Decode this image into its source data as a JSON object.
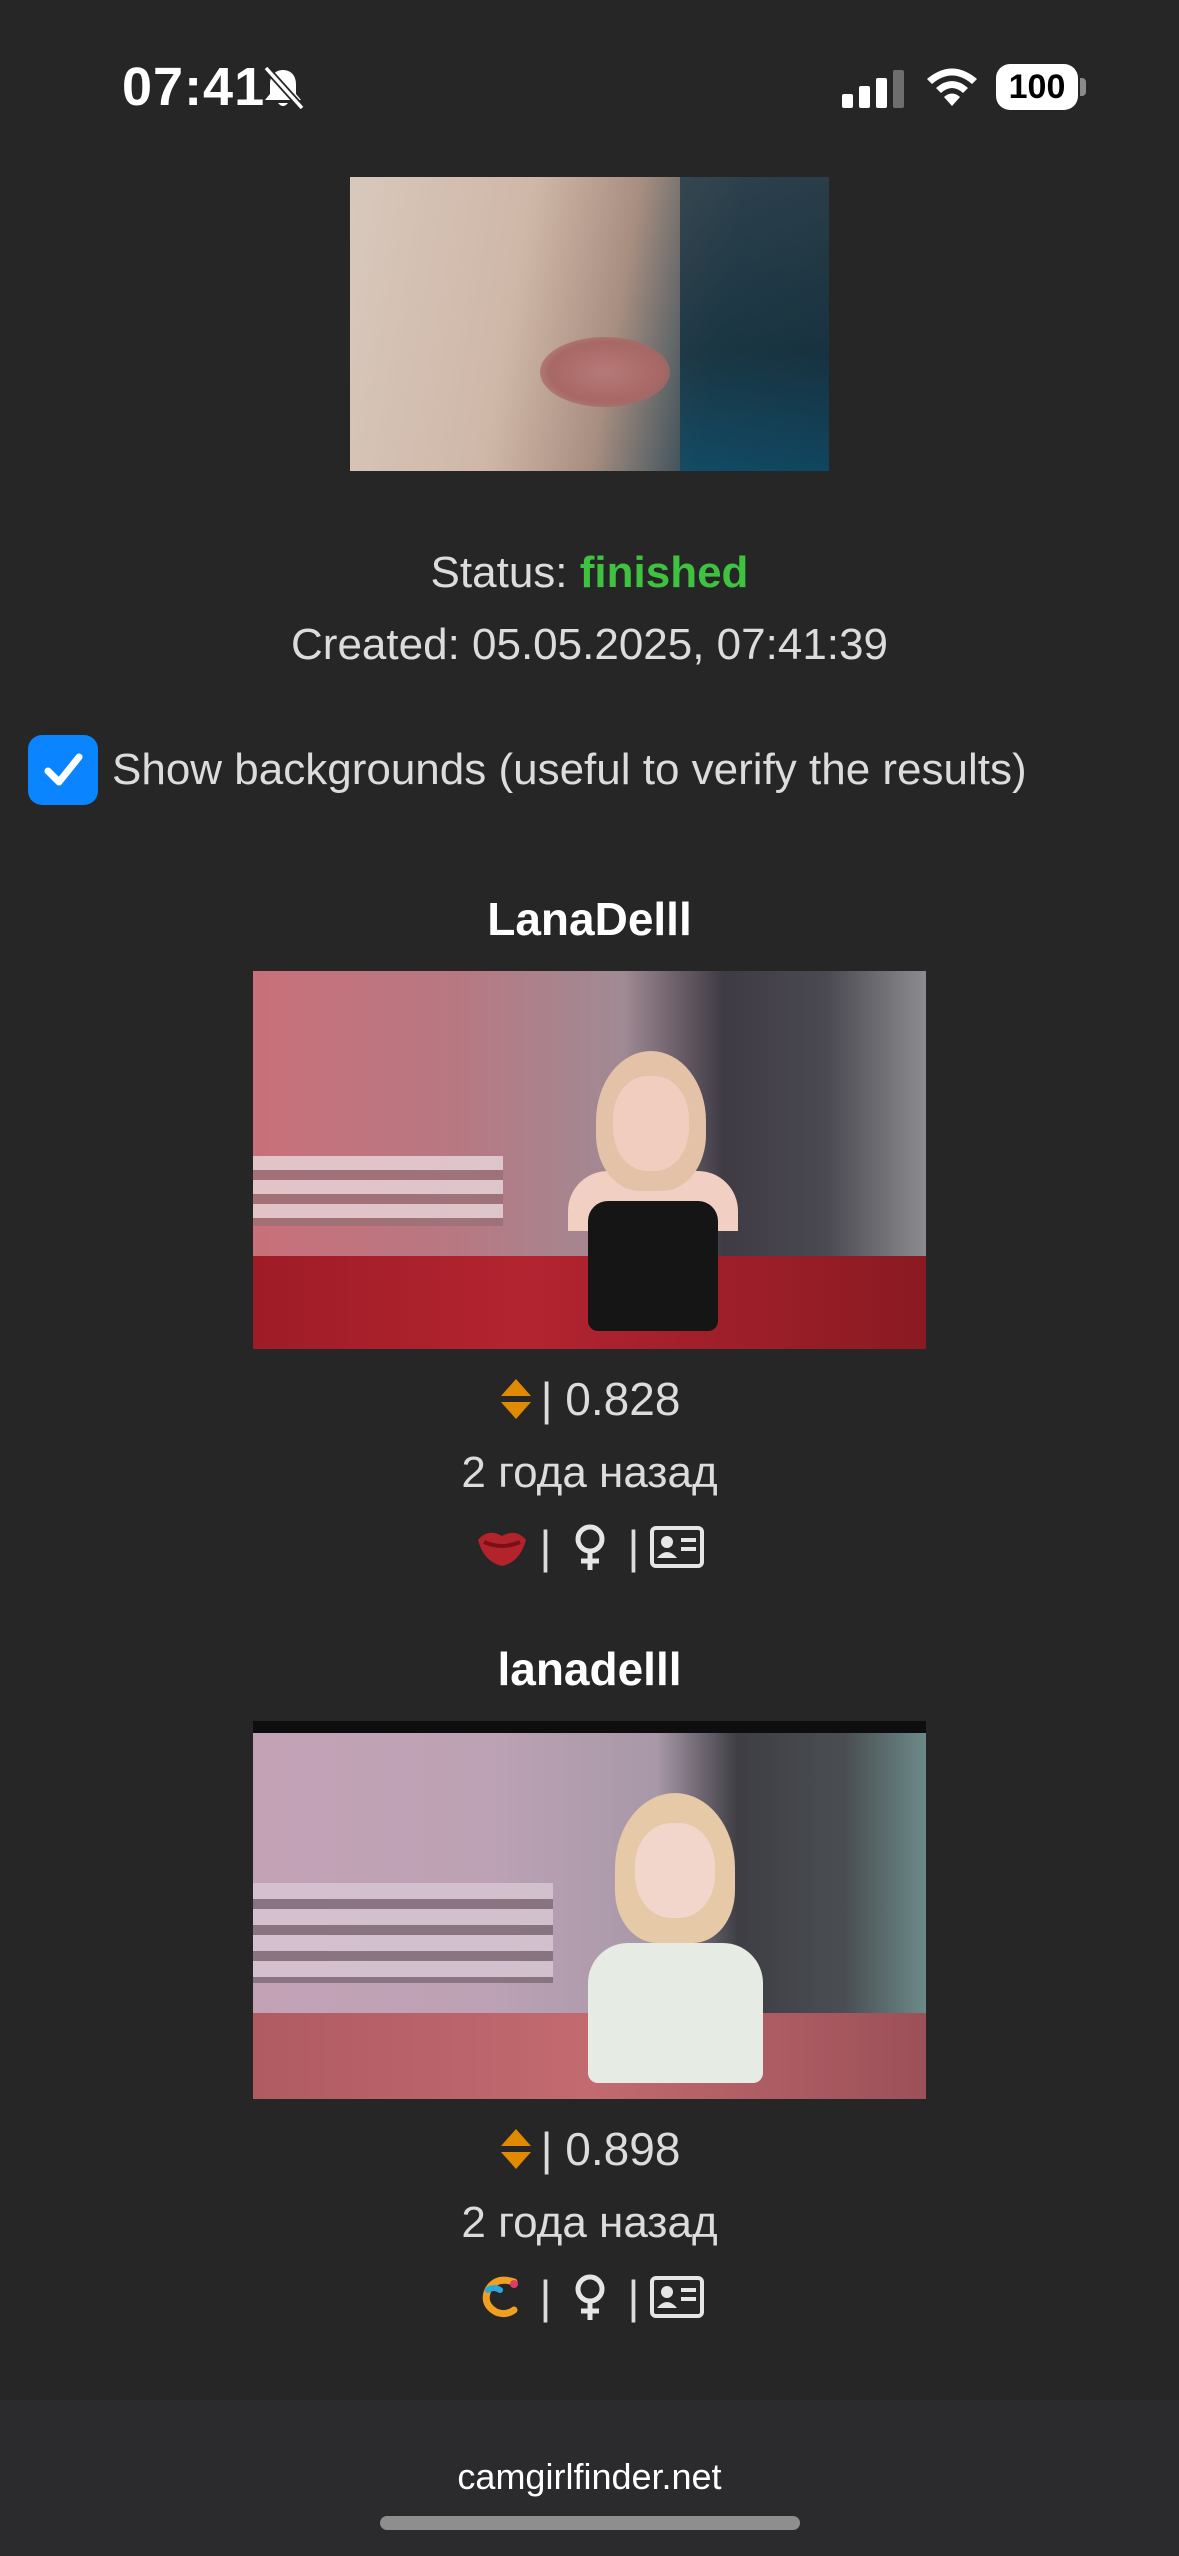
{
  "status_bar": {
    "time": "07:41",
    "battery": "100",
    "icons": [
      "bell-slash-icon",
      "signal-icon",
      "wifi-icon",
      "battery-icon"
    ]
  },
  "status": {
    "label": "Status:",
    "value": "finished",
    "value_color": "#3fc23f"
  },
  "created": {
    "text": "Created: 05.05.2025, 07:41:39"
  },
  "show_backgrounds": {
    "checked": true,
    "label": "Show backgrounds (useful to verify the results)",
    "accent": "#0a84ff"
  },
  "results": [
    {
      "name": "LanaDelll",
      "score": "| 0.828",
      "age": "2 года назад",
      "platform_icon": "red-lips-logo-icon",
      "gender_icon": "female-symbol-icon",
      "profile_icon": "id-card-icon",
      "separator": "|"
    },
    {
      "name": "lanadelll",
      "score": "| 0.898",
      "age": "2 года назад",
      "platform_icon": "colorful-c-logo-icon",
      "gender_icon": "female-symbol-icon",
      "profile_icon": "id-card-icon",
      "separator": "|"
    }
  ],
  "footer": {
    "site": "camgirlfinder.net"
  }
}
